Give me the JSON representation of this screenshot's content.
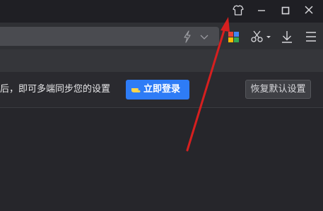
{
  "window": {
    "controls": [
      "skin-icon",
      "minimize-icon",
      "maximize-icon",
      "close-icon"
    ]
  },
  "toolbar": {
    "icons": [
      "lightning-icon",
      "chevron-down-icon",
      "app-grid-icon",
      "scissors-icon",
      "download-icon",
      "menu-icon"
    ]
  },
  "sync": {
    "message": "后，即可多端同步您的设置",
    "login_label": "立即登录",
    "reset_label": "恢复默认设置"
  },
  "colors": {
    "accent": "#2e7cf6",
    "annotation_arrow": "#d61f1f",
    "background": "#26262b"
  }
}
